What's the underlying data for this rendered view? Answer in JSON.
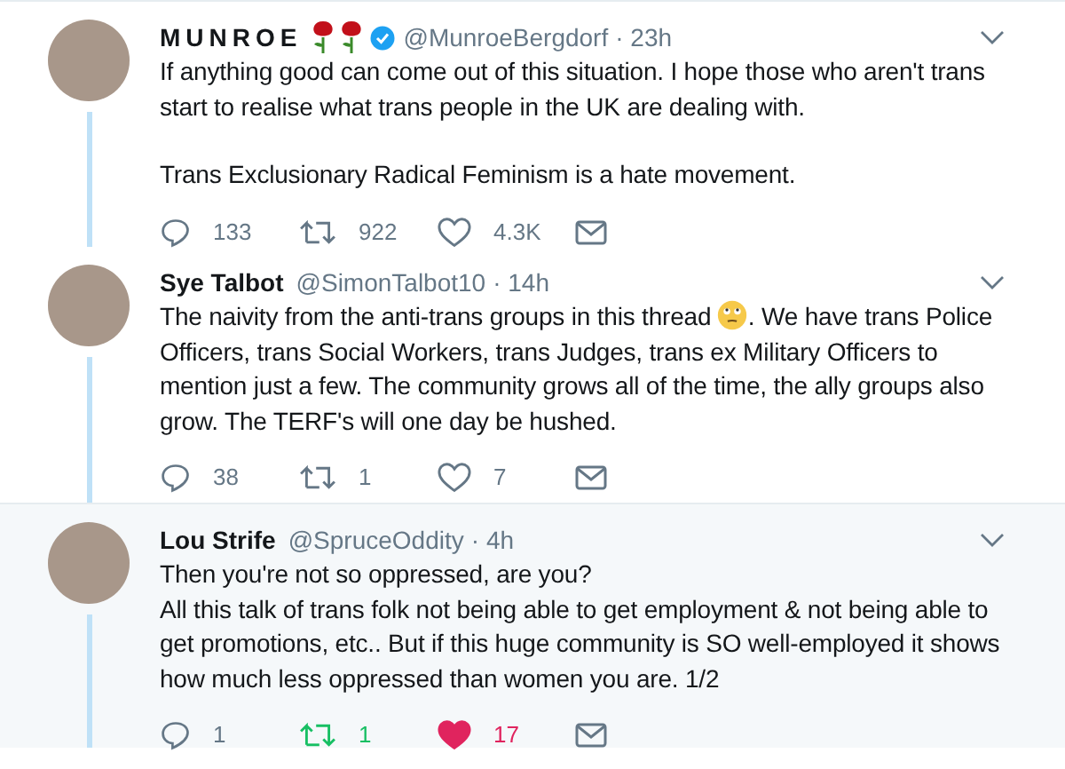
{
  "tweets": [
    {
      "kind": "spaced",
      "name": "MUNROE",
      "name_emoji": [
        {
          "kind": "rose"
        },
        {
          "kind": "rose"
        }
      ],
      "verified": true,
      "handle": "@MunroeBergdorf",
      "time": "· 23h",
      "highlighted": false,
      "body": [
        {
          "lines": [
            [
              {
                "kind": "text",
                "text": "If anything good can come out of this situation. I hope those who aren't trans start to realise what trans people in the UK are dealing with."
              }
            ]
          ]
        },
        {
          "lines": [
            [
              {
                "kind": "text",
                "text": "Trans Exclusionary Radical Feminism is a hate movement."
              }
            ]
          ]
        }
      ],
      "replies": "133",
      "retweets": "922",
      "retweeted": false,
      "likes": "4.3K",
      "liked": false
    },
    {
      "kind": "plain",
      "name": "Sye Talbot",
      "verified": false,
      "handle": "@SimonTalbot10",
      "time": "· 14h",
      "highlighted": false,
      "body": [
        {
          "lines": [
            [
              {
                "kind": "text",
                "text": "The naivity from the anti-trans groups in this thread "
              },
              {
                "kind": "emoji"
              },
              {
                "kind": "text",
                "text": ". We have trans Police Officers, trans Social Workers, trans Judges, trans ex Military Officers to mention just a few. The community grows all of the time, the ally groups also grow. The TERF's will one day be hushed."
              }
            ]
          ]
        }
      ],
      "replies": "38",
      "retweets": "1",
      "retweeted": false,
      "likes": "7",
      "liked": false
    },
    {
      "kind": "plain",
      "name": "Lou Strife",
      "verified": false,
      "handle": "@SpruceOddity",
      "time": "· 4h",
      "highlighted": true,
      "body": [
        {
          "lines": [
            [
              {
                "kind": "text",
                "text": "Then you're not so oppressed, are you?"
              }
            ],
            [
              {
                "kind": "text",
                "text": "All this talk of trans folk not being able to get employment & not being able to get promotions, etc.. But if this huge community is SO well-employed it shows how much less oppressed than women you are. 1/2"
              }
            ]
          ]
        }
      ],
      "replies": "1",
      "retweets": "1",
      "retweeted": true,
      "likes": "17",
      "liked": true
    }
  ]
}
